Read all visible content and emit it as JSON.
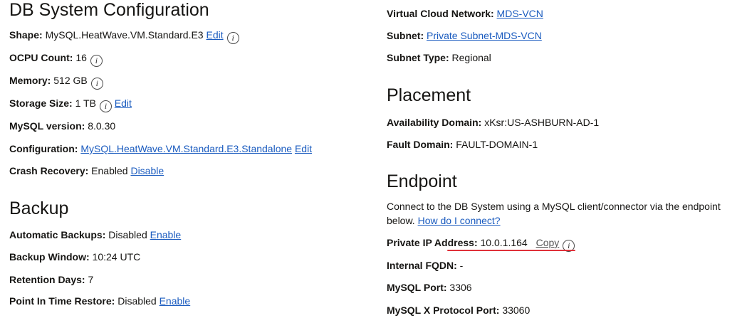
{
  "left": {
    "db": {
      "title": "DB System Configuration",
      "shape_label": "Shape:",
      "shape_value": "MySQL.HeatWave.VM.Standard.E3",
      "shape_edit": "Edit",
      "ocpu_label": "OCPU Count:",
      "ocpu_value": "16",
      "memory_label": "Memory:",
      "memory_value": "512 GB",
      "storage_label": "Storage Size:",
      "storage_value": "1 TB",
      "storage_edit": "Edit",
      "mysql_label": "MySQL version:",
      "mysql_value": "8.0.30",
      "config_label": "Configuration:",
      "config_value": "MySQL.HeatWave.VM.Standard.E3.Standalone",
      "config_edit": "Edit",
      "crash_label": "Crash Recovery:",
      "crash_value": "Enabled",
      "crash_action": "Disable"
    },
    "backup": {
      "title": "Backup",
      "auto_label": "Automatic Backups:",
      "auto_value": "Disabled",
      "auto_action": "Enable",
      "window_label": "Backup Window:",
      "window_value": "10:24 UTC",
      "retention_label": "Retention Days:",
      "retention_value": "7",
      "pitr_label": "Point In Time Restore:",
      "pitr_value": "Disabled",
      "pitr_action": "Enable"
    }
  },
  "right": {
    "network": {
      "vcn_label": "Virtual Cloud Network:",
      "vcn_value": "MDS-VCN",
      "subnet_label": "Subnet:",
      "subnet_value": "Private Subnet-MDS-VCN",
      "subnet_type_label": "Subnet Type:",
      "subnet_type_value": "Regional"
    },
    "placement": {
      "title": "Placement",
      "ad_label": "Availability Domain:",
      "ad_value": "xKsr:US-ASHBURN-AD-1",
      "fd_label": "Fault Domain:",
      "fd_value": "FAULT-DOMAIN-1"
    },
    "endpoint": {
      "title": "Endpoint",
      "desc": "Connect to the DB System using a MySQL client/connector via the endpoint below.",
      "howto": "How do I connect?",
      "ip_label": "Private IP Address:",
      "ip_value": "10.0.1.164",
      "copy": "Copy",
      "fqdn_label": "Internal FQDN:",
      "fqdn_value": "-",
      "port_label": "MySQL Port:",
      "port_value": "3306",
      "xport_label": "MySQL X Protocol Port:",
      "xport_value": "33060"
    }
  },
  "icons": {
    "info": "i"
  },
  "colors": {
    "link": "#1a5bbf",
    "annotation": "#e0313a"
  }
}
